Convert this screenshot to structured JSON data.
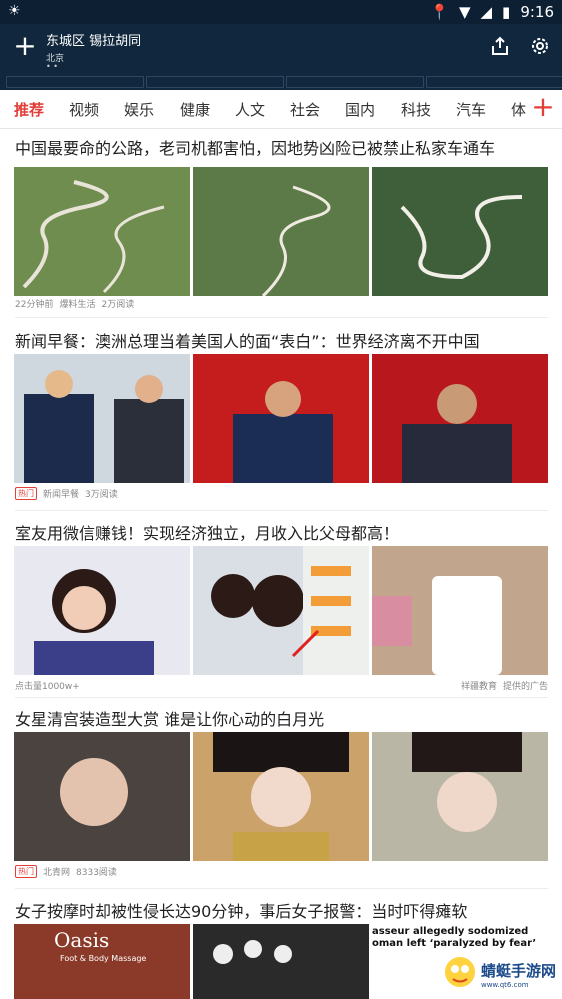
{
  "status": {
    "time": "9:16"
  },
  "appbar": {
    "district": "东城区 锡拉胡同",
    "city": "北京",
    "dots": "• •"
  },
  "tabs": [
    "推荐",
    "视频",
    "娱乐",
    "健康",
    "人文",
    "社会",
    "国内",
    "科技",
    "汽车",
    "体"
  ],
  "articles": [
    {
      "title": "中国最要命的公路，老司机都害怕，因地势凶险已被禁止私家车通车",
      "meta": [
        "22分钟前",
        "爆料生活",
        "2万阅读"
      ],
      "hot": false
    },
    {
      "title": "新闻早餐：澳洲总理当着美国人的面“表白”：世界经济离不开中国",
      "meta": [
        "新闻早餐",
        "3万阅读"
      ],
      "hot": true,
      "hot_label": "热门"
    },
    {
      "title": "室友用微信赚钱！实现经济独立，月收入比父母都高！",
      "meta": [
        "点击量1000w+"
      ],
      "ad_right": [
        "祥疆教育",
        "提供的广告"
      ]
    },
    {
      "title": "女星清宫装造型大赏 谁是让你心动的白月光",
      "meta": [
        "北青网",
        "8333阅读"
      ],
      "hot": true,
      "hot_label": "热门"
    },
    {
      "title": "女子按摩时却被性侵长达90分钟，事后女子报警：当时吓得瘫软",
      "meta": []
    }
  ],
  "image_text": {
    "oasis": "Oasis",
    "oasis_sub": "Foot & Body Massage",
    "news_line1": "asseur allegedly sodomized",
    "news_line2": "oman left ‘paralyzed by fear’"
  },
  "watermark": {
    "title": "蜻蜓手游网",
    "url": "www.qt6.com"
  }
}
